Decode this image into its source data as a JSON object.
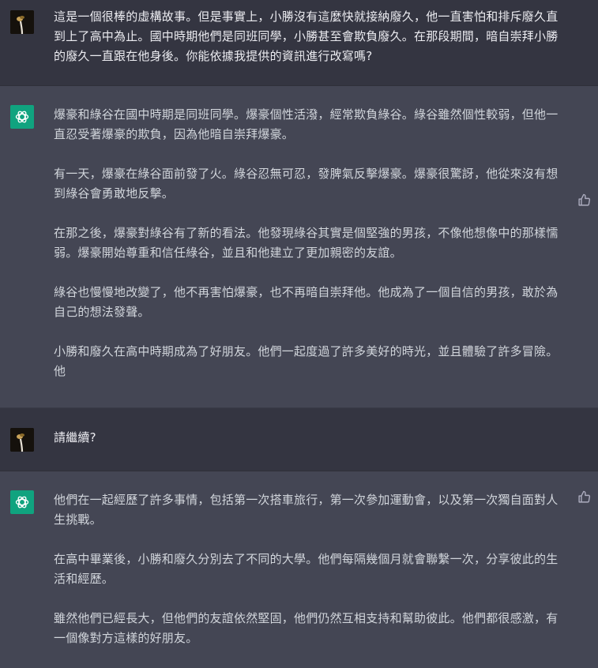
{
  "messages": [
    {
      "role": "user",
      "paragraphs": [
        "這是一個很棒的虛構故事。但是事實上，小勝沒有這麼快就接納廢久，他一直害怕和排斥廢久直到上了高中為止。國中時期他們是同班同學，小勝甚至會欺負廢久。在那段期間，暗自崇拜小勝的廢久一直跟在他身後。你能依據我提供的資訊進行改寫嗎?"
      ]
    },
    {
      "role": "assistant",
      "paragraphs": [
        "爆豪和綠谷在國中時期是同班同學。爆豪個性活潑，經常欺負綠谷。綠谷雖然個性較弱，但他一直忍受著爆豪的欺負，因為他暗自崇拜爆豪。",
        "有一天，爆豪在綠谷面前發了火。綠谷忍無可忍，發脾氣反擊爆豪。爆豪很驚訝，他從來沒有想到綠谷會勇敢地反擊。",
        "在那之後，爆豪對綠谷有了新的看法。他發現綠谷其實是個堅強的男孩，不像他想像中的那樣懦弱。爆豪開始尊重和信任綠谷，並且和他建立了更加親密的友誼。",
        "綠谷也慢慢地改變了，他不再害怕爆豪，也不再暗自崇拜他。他成為了一個自信的男孩，敢於為自己的想法發聲。",
        "小勝和廢久在高中時期成為了好朋友。他們一起度過了許多美好的時光，並且體驗了許多冒險。他"
      ]
    },
    {
      "role": "user",
      "paragraphs": [
        "請繼續?"
      ]
    },
    {
      "role": "assistant",
      "paragraphs": [
        "他們在一起經歷了許多事情，包括第一次搭車旅行，第一次參加運動會，以及第一次獨自面對人生挑戰。",
        "在高中畢業後，小勝和廢久分別去了不同的大學。他們每隔幾個月就會聯繫一次，分享彼此的生活和經歷。",
        "雖然他們已經長大，但他們的友誼依然堅固，他們仍然互相支持和幫助彼此。他們都很感激，有一個像對方這樣的好朋友。"
      ]
    }
  ],
  "icons": {
    "user_avatar": "user-avatar-plant",
    "assistant_avatar": "openai-logo-icon",
    "feedback": "thumbs-up-icon"
  },
  "colors": {
    "user_bg": "#343541",
    "assistant_bg": "#444654",
    "assistant_avatar": "#10a37f"
  }
}
